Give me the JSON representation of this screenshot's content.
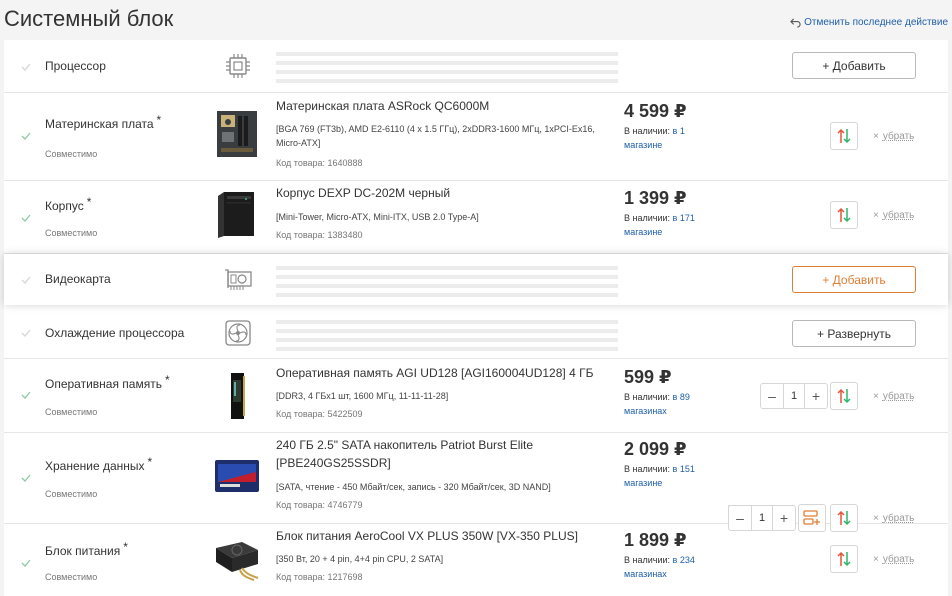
{
  "page": {
    "title": "Системный блок",
    "undo_label": "Отменить последнее действие"
  },
  "colors": {
    "accent_orange": "#e07e35",
    "link_blue": "#1f5fa8",
    "check_green": "#8fc9a6",
    "arrow_red": "#e5543b",
    "arrow_green": "#2fb56a"
  },
  "labels": {
    "compatible": "Совместимо",
    "required_mark": "*",
    "remove": "убрать",
    "remove_x": "×",
    "in_stock_prefix": "В наличии:",
    "minus": "–",
    "plus": "+"
  },
  "rows": {
    "cpu": {
      "name": "Процессор",
      "button": "+ Добавить",
      "icon": "cpu-icon"
    },
    "motherboard": {
      "name": "Материнская плата",
      "title": "Материнская плата ASRock QC6000M",
      "specs": "[BGA 769 (FT3b), AMD E2-6110 (4 x 1.5 ГГц), 2xDDR3-1600 МГц, 1xPCI-Ex16, Micro-ATX]",
      "code": "Код товара: 1640888",
      "price": "4 599 ₽",
      "avail_link": "в 1 магазине"
    },
    "case": {
      "name": "Корпус",
      "title": "Корпус DEXP DC-202M черный",
      "specs": "[Mini-Tower, Micro-ATX, Mini-ITX, USB 2.0 Type-A]",
      "code": "Код товара: 1383480",
      "price": "1 399 ₽",
      "avail_link": "в 171 магазине"
    },
    "gpu": {
      "name": "Видеокарта",
      "button": "+ Добавить",
      "icon": "gpu-icon"
    },
    "cooling": {
      "name": "Охлаждение процессора",
      "button": "+ Развернуть",
      "icon": "fan-icon"
    },
    "ram": {
      "name": "Оперативная память",
      "title": "Оперативная память AGI UD128 [AGI160004UD128] 4 ГБ",
      "specs": "[DDR3, 4 ГБx1 шт, 1600 МГц, 11-11-11-28]",
      "code": "Код товара: 5422509",
      "price": "599 ₽",
      "avail_link": "в 89 магазинах",
      "qty": "1"
    },
    "storage": {
      "name": "Хранение данных",
      "title": "240 ГБ 2.5\" SATA накопитель Patriot Burst Elite [PBE240GS25SSDR]",
      "specs": "[SATA, чтение - 450 Мбайт/сек, запись - 320 Мбайт/сек, 3D NAND]",
      "code": "Код товара: 4746779",
      "price": "2 099 ₽",
      "avail_link": "в 151 магазине",
      "qty": "1"
    },
    "psu": {
      "name": "Блок питания",
      "title": "Блок питания AeroCool VX PLUS 350W [VX-350 PLUS]",
      "specs": "[350 Вт, 20 + 4 pin, 4+4 pin CPU, 2 SATA]",
      "code": "Код товара: 1217698",
      "price": "1 899 ₽",
      "avail_link": "в 234 магазинах"
    }
  }
}
